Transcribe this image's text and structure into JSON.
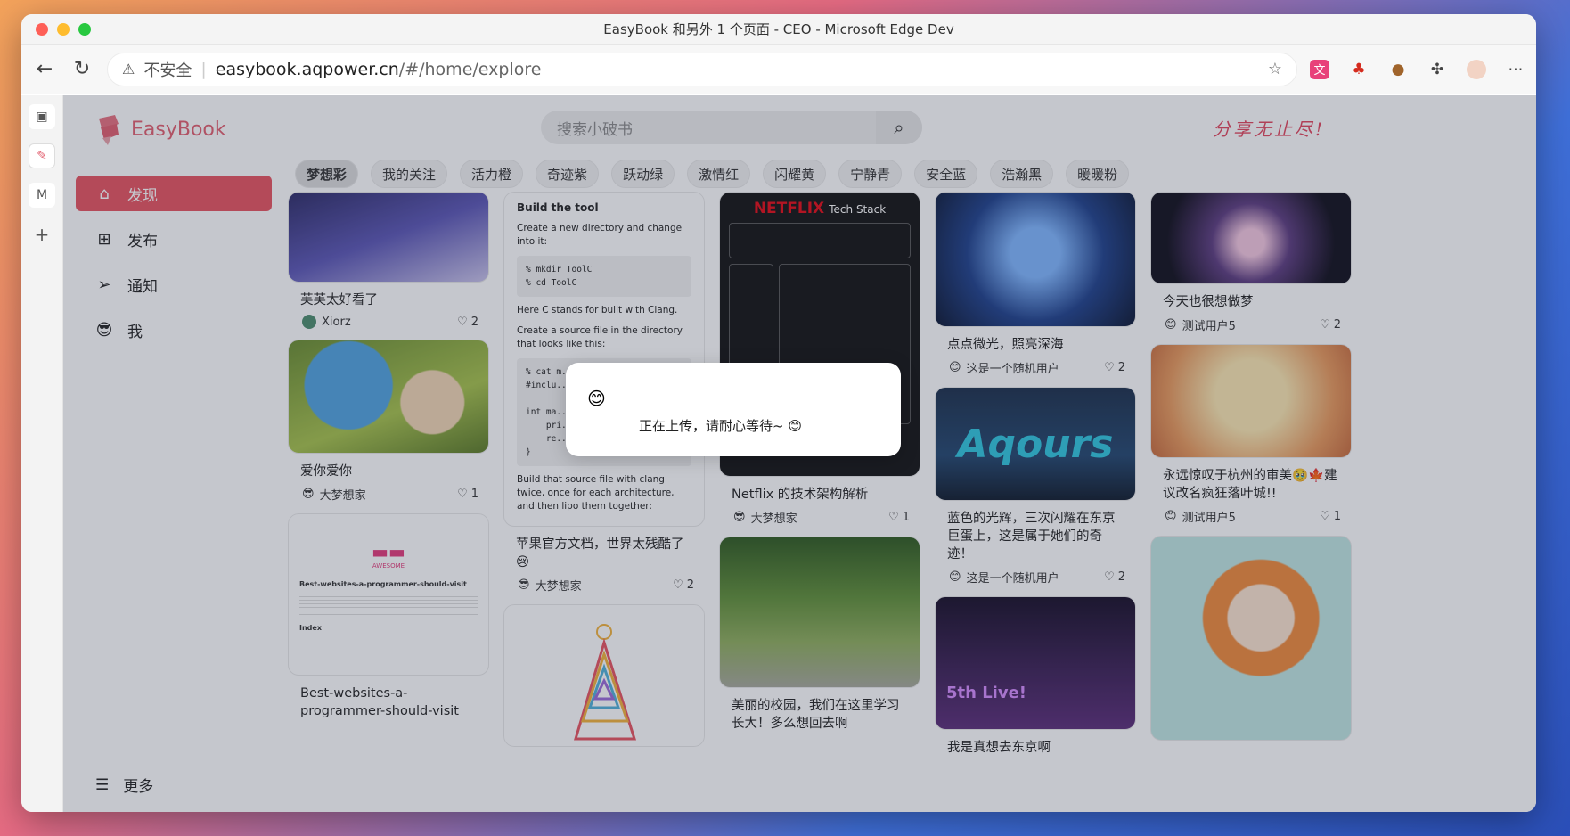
{
  "window": {
    "title": "EasyBook 和另外 1 个页面 - CEO - Microsoft Edge Dev"
  },
  "addressbar": {
    "insecure": "不安全",
    "host": "easybook.aqpower.cn",
    "path": "/#/home/explore"
  },
  "strip": {
    "m_label": "M"
  },
  "logo": {
    "text": "EasyBook"
  },
  "search": {
    "placeholder": "搜索小破书"
  },
  "slogan": "分享无止尽!",
  "sidebar": {
    "items": [
      {
        "label": "发现",
        "icon": "home-icon"
      },
      {
        "label": "发布",
        "icon": "publish-icon"
      },
      {
        "label": "通知",
        "icon": "send-icon"
      },
      {
        "label": "我",
        "icon": "avatar-icon"
      }
    ],
    "more": "更多"
  },
  "tabs": [
    "梦想彩",
    "我的关注",
    "活力橙",
    "奇迹紫",
    "跃动绿",
    "激情红",
    "闪耀黄",
    "宁静青",
    "安全蓝",
    "浩瀚黑",
    "暖暖粉"
  ],
  "cards": {
    "c1": {
      "title": "芙芙太好看了",
      "author": "Xiorz",
      "likes": "2"
    },
    "c2": {
      "title": "爱你爱你",
      "author": "大梦想家",
      "likes": "1"
    },
    "c3": {
      "title": "Best-websites-a-programmer-should-visit",
      "sub": "Best-websites-a-programmer-should-visit",
      "logo": "AWESOME",
      "index": "Index"
    },
    "c4": {
      "title": "苹果官方文档，世界太残酷了😢",
      "author": "大梦想家",
      "likes": "2",
      "doc_heading": "Build the tool",
      "doc_p1": "Create a new directory and change into it:",
      "doc_code1": "% mkdir ToolC\n% cd ToolC",
      "doc_p2": "Here C stands for built with Clang.",
      "doc_p3": "Create a source file in the directory that looks like this:",
      "doc_code2": "% cat m...\n#inclu...\n\nint ma...\n    pri...\n    re...\n}",
      "doc_p4": "Build that source file with clang twice, once for each architecture, and then lipo them together:"
    },
    "c5": {
      "title": "Netflix 的技术架构解析",
      "author": "大梦想家",
      "likes": "1",
      "img_title": "NETFLIX",
      "img_sub": "Tech Stack"
    },
    "c6": {
      "title": "美丽的校园，我们在这里学习长大！多么想回去啊"
    },
    "c7": {
      "title": "点点微光，照亮深海",
      "author": "这是一个随机用户",
      "likes": "2"
    },
    "c8": {
      "title": "蓝色的光辉，三次闪耀在东京巨蛋上，这是属于她们的奇迹！",
      "author": "这是一个随机用户",
      "likes": "2",
      "img_text": "Aqours"
    },
    "c9": {
      "title": "我是真想去东京啊",
      "img_text": "5th Live!"
    },
    "c10": {
      "title": "今天也很想做梦",
      "author": "测试用户5",
      "likes": "2"
    },
    "c11": {
      "title": "永远惊叹于杭州的审美🥹🍁建议改名疯狂落叶城!!",
      "author": "测试用户5",
      "likes": "1"
    }
  },
  "toast": {
    "emoji": "😊",
    "message": "正在上传，请耐心等待~ 😊"
  }
}
